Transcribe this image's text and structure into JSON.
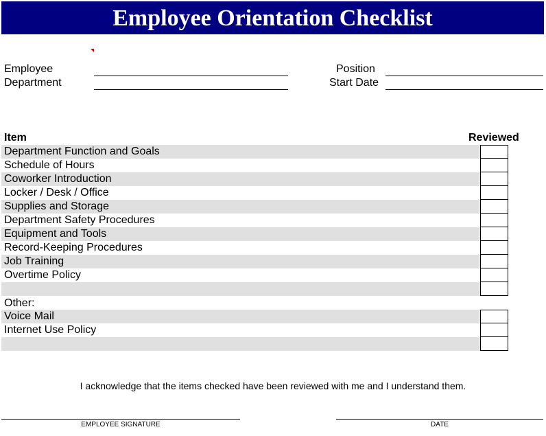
{
  "title": "Employee Orientation Checklist",
  "colors": {
    "title_bg": "#000080",
    "title_text": "#ffffff",
    "row_shade": "#e0e0e0",
    "comment_marker": "#e00000"
  },
  "fields": {
    "employee": {
      "label": "Employee",
      "value": ""
    },
    "department": {
      "label": "Department",
      "value": ""
    },
    "position": {
      "label": "Position",
      "value": ""
    },
    "start_date": {
      "label": "Start Date",
      "value": ""
    }
  },
  "checklist": {
    "item_header": "Item",
    "reviewed_header": "Reviewed",
    "items": [
      {
        "label": "Department Function and Goals",
        "reviewed": false
      },
      {
        "label": "Schedule of Hours",
        "reviewed": false
      },
      {
        "label": "Coworker Introduction",
        "reviewed": false
      },
      {
        "label": "Locker / Desk / Office",
        "reviewed": false
      },
      {
        "label": "Supplies and Storage",
        "reviewed": false
      },
      {
        "label": "Department Safety Procedures",
        "reviewed": false
      },
      {
        "label": "Equipment and Tools",
        "reviewed": false
      },
      {
        "label": "Record-Keeping Procedures",
        "reviewed": false
      },
      {
        "label": "Job Training",
        "reviewed": false
      },
      {
        "label": "Overtime Policy",
        "reviewed": false
      },
      {
        "label": "",
        "reviewed": false
      }
    ],
    "other_label": "Other:",
    "other_items": [
      {
        "label": "Voice Mail",
        "reviewed": false
      },
      {
        "label": "Internet Use Policy",
        "reviewed": false
      },
      {
        "label": "",
        "reviewed": false
      }
    ]
  },
  "acknowledgement": "I acknowledge that the items checked have been reviewed with me and I understand them.",
  "signature": {
    "employee_label": "EMPLOYEE SIGNATURE",
    "date_label": "DATE"
  }
}
